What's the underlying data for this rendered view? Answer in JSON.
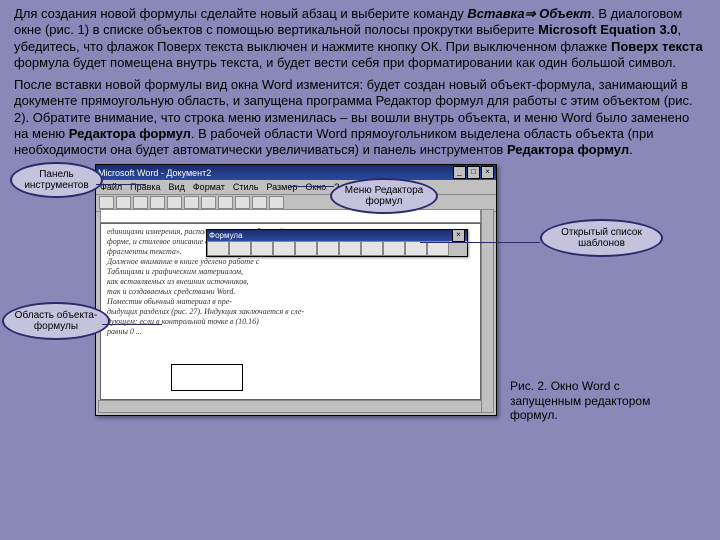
{
  "p1": {
    "t1": "Для создания новой формулы сделайте новый абзац и выберите команду ",
    "cmd1": "Вставка",
    "arrow": "⇒ ",
    "cmd2": "Объект",
    "t2": ". В диалоговом окне (рис. 1) в списке объектов с помощью вертикальной полосы прокрутки выберите ",
    "ms": "Microsoft Equation 3.0",
    "t3": ", убедитесь, что флажок Поверх текста выключен и нажмите кнопку ОК. При выключенном флажке ",
    "flag": "Поверх текста",
    "t4": " формула будет помещена внутрь текста, и будет вести себя при форматировании как один большой символ."
  },
  "p2": {
    "t1": "После вставки новой формулы вид окна Word изменится: будет создан новый объект-формула, занимающий в документе прямоугольную область, и запущена программа Редактор формул для работы с этим объектом (рис. 2). Обратите внимание, что строка меню изменилась – вы вошли внутрь объекта, и меню Word было заменено на меню ",
    "rf1": "Редактора формул",
    "t2": ". В рабочей области Word прямоугольником выделена область объекта (при необходимости она будет автоматически увеличиваться) и панель инструментов ",
    "rf2": "Редактора формул",
    "t3": "."
  },
  "win": {
    "title": "Microsoft Word - Документ2",
    "menu": [
      "Файл",
      "Правка",
      "Вид",
      "Формат",
      "Стиль",
      "Размер",
      "Окно",
      "?"
    ],
    "eqtitle": "Формула",
    "doclines": [
      "единицами измерения, расположенные в табличной",
      "форме, и стилевое описание в виде сот. «Стиль –",
      "фрагменты текста».",
      "Должное внимание в книге уделено работе с",
      "Таблицами и графическим материалом,",
      "как вставляемых из внешних источников,",
      "так и создаваемых средствами Word.",
      "Поместив обычный материал в пре-",
      "дыдущих разделах (рис. 27). Индукция заключается в сле-",
      "дующем: если в контрольной точке в (10.16)",
      "равны 0 ..."
    ]
  },
  "callouts": {
    "c1": "Панель инструментов",
    "c2": "Меню Редактора формул",
    "c3": "Открытый список шаблонов",
    "c4": "Область объекта-формулы"
  },
  "caption": "Рис. 2. Окно Word с запущенным редактором формул."
}
